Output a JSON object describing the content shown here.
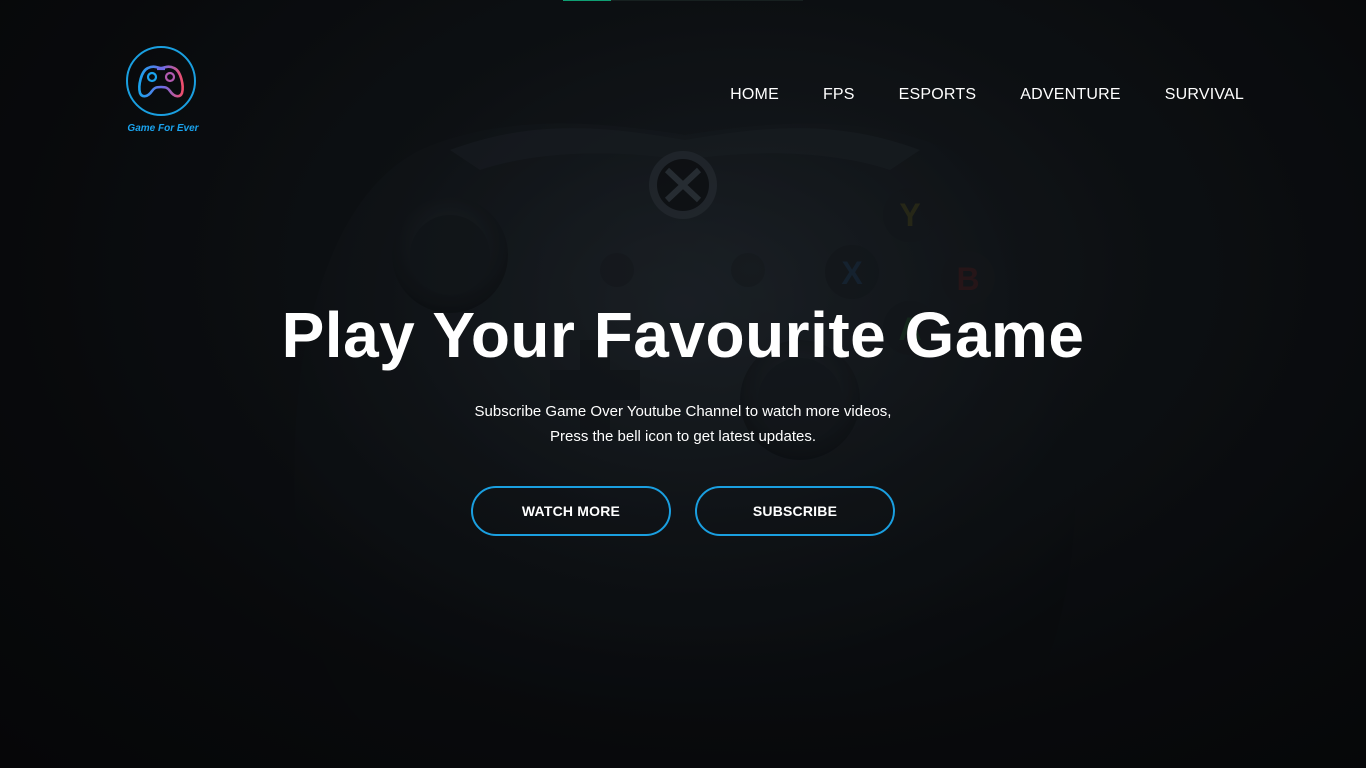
{
  "brand": {
    "name": "Game For Ever",
    "logo_icon": "gamepad-icon",
    "accent_color": "#1a9fe0"
  },
  "nav": {
    "items": [
      {
        "label": "HOME"
      },
      {
        "label": "FPS"
      },
      {
        "label": "ESPORTS"
      },
      {
        "label": "ADVENTURE"
      },
      {
        "label": "SURVIVAL"
      }
    ]
  },
  "hero": {
    "title": "Play Your Favourite Game",
    "subtitle_line1": "Subscribe Game Over Youtube Channel to watch more videos,",
    "subtitle_line2": "Press the bell icon to get latest updates.",
    "background_image": "game-controller-photo"
  },
  "buttons": {
    "watch_more": "WATCH MORE",
    "subscribe": "SUBSCRIBE"
  },
  "top_progress": {
    "value": 0.2,
    "color": "#14d49a"
  }
}
